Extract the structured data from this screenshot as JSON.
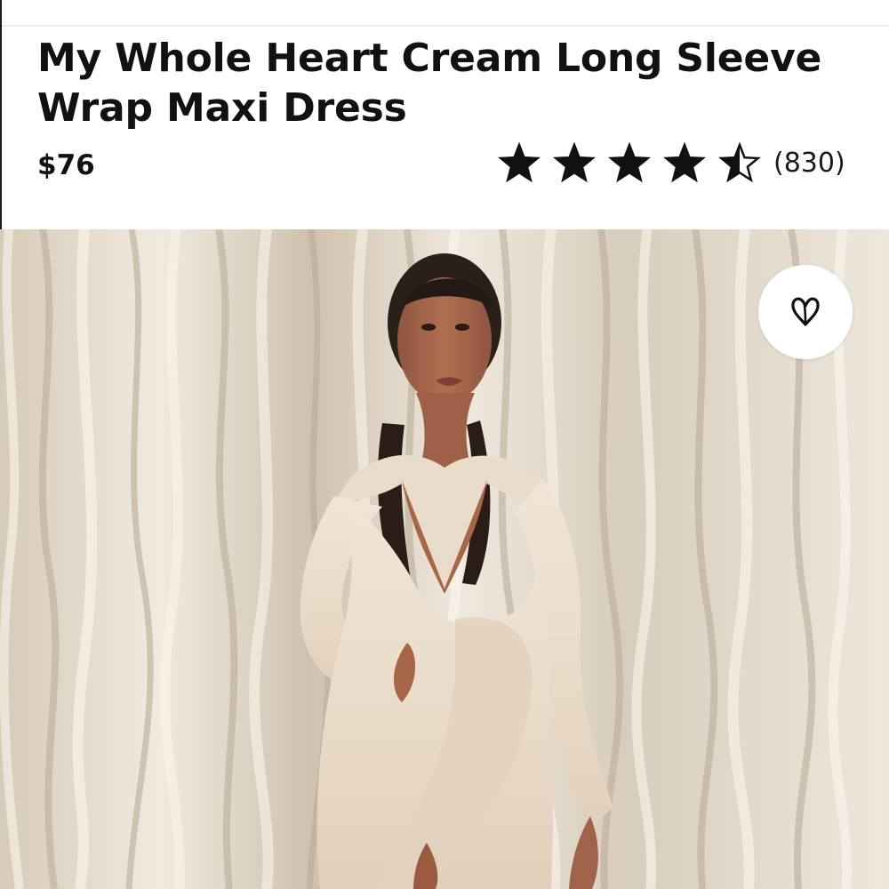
{
  "product": {
    "title": "My Whole Heart Cream Long Sleeve Wrap Maxi Dress",
    "price": "$76",
    "rating": {
      "stars": 4.5,
      "max_stars": 5,
      "review_count": "(830)"
    }
  },
  "image": {
    "subject": "model wearing cream wrap maxi dress",
    "colors": {
      "backdrop": "#d8cebd",
      "dress": "#eadccb",
      "skin": "#a8694d"
    }
  },
  "wishlist": {
    "icon": "heart-icon"
  }
}
